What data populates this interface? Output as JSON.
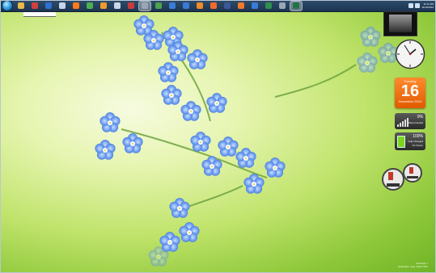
{
  "taskbar": {
    "items": [
      {
        "name": "explorer",
        "color": "#e8b84a"
      },
      {
        "name": "media",
        "color": "#d04040"
      },
      {
        "name": "app-blue",
        "color": "#2f6fd1"
      },
      {
        "name": "document",
        "color": "#c6d7ec"
      },
      {
        "name": "firefox",
        "color": "#ff7a1a"
      },
      {
        "name": "chrome",
        "color": "#4caf50"
      },
      {
        "name": "app-orange",
        "color": "#f09a2b"
      },
      {
        "name": "app-folder",
        "color": "#c8d7ea"
      },
      {
        "name": "app-red",
        "color": "#c83b3b"
      },
      {
        "name": "app-grey",
        "color": "#9aa6b4"
      },
      {
        "name": "app-green",
        "color": "#4ba34b"
      },
      {
        "name": "app-blue2",
        "color": "#3a7bd5"
      },
      {
        "name": "app-blue3",
        "color": "#3a7bd5"
      },
      {
        "name": "app-orange2",
        "color": "#f08a2b"
      },
      {
        "name": "app-orange3",
        "color": "#f06a2b"
      },
      {
        "name": "facebook",
        "color": "#3b5998"
      },
      {
        "name": "app-orange4",
        "color": "#f0782b"
      },
      {
        "name": "app-blue4",
        "color": "#3a7bd5"
      },
      {
        "name": "app-green2",
        "color": "#2f8f4f"
      },
      {
        "name": "app-grey2",
        "color": "#9aa6b4"
      },
      {
        "name": "excel",
        "color": "#217346"
      }
    ],
    "clock_time": "11:21 AM",
    "clock_date": "11/16/2010"
  },
  "gadgets": {
    "calendar": {
      "weekday": "Tuesday",
      "day": "16",
      "month_year": "November 2010"
    },
    "wifi": {
      "percent": "0%",
      "status": "Disconnected"
    },
    "battery": {
      "percent": "100%",
      "line1": "Fully Charged",
      "line2": "AC Power"
    }
  },
  "watermark": {
    "line1": "Windows 7",
    "line2": "Evaluation copy. Build 7601"
  },
  "colors": {
    "accent_orange": "#e15a00",
    "taskbar": "#1c3450"
  }
}
